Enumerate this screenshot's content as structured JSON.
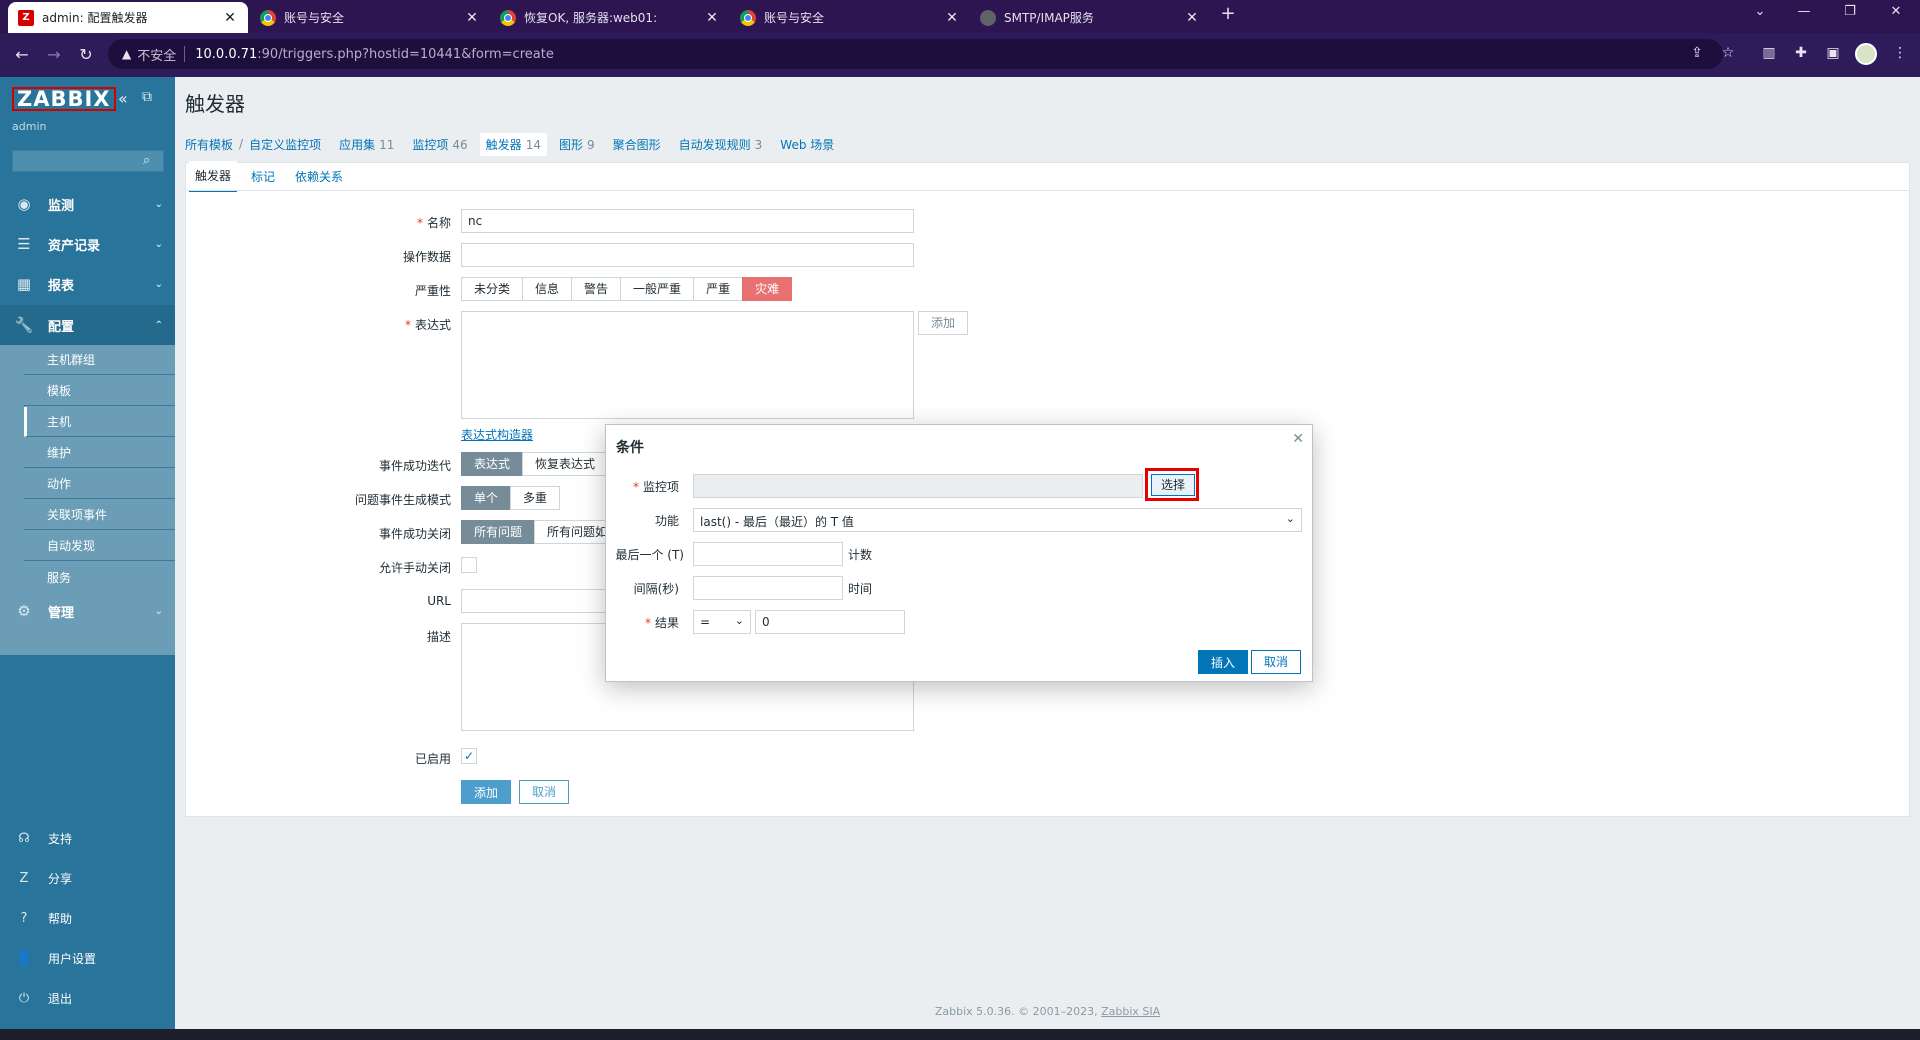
{
  "browser": {
    "tabs": [
      {
        "title": "admin: 配置触发器",
        "icon": "zabbix-icon",
        "active": true
      },
      {
        "title": "账号与安全",
        "icon": "chrome-icon"
      },
      {
        "title": "恢复OK, 服务器:web01:",
        "icon": "chrome-icon"
      },
      {
        "title": "账号与安全",
        "icon": "chrome-icon"
      },
      {
        "title": "SMTP/IMAP服务",
        "icon": "globe-icon"
      }
    ],
    "insecure_label": "不安全",
    "url_host": "10.0.0.71",
    "url_path": ":90/triggers.php?hostid=10441&form=create"
  },
  "sidebar": {
    "logo": "ZABBIX",
    "user": "admin",
    "menu": [
      {
        "label": "监测",
        "icon": "eye-icon"
      },
      {
        "label": "资产记录",
        "icon": "list-icon"
      },
      {
        "label": "报表",
        "icon": "chart-icon"
      },
      {
        "label": "配置",
        "icon": "wrench-icon"
      },
      {
        "label": "管理",
        "icon": "gear-icon"
      }
    ],
    "config_submenu": [
      "主机群组",
      "模板",
      "主机",
      "维护",
      "动作",
      "关联项事件",
      "自动发现",
      "服务"
    ],
    "bottom": [
      {
        "label": "支持",
        "icon": "headset-icon"
      },
      {
        "label": "分享",
        "icon": "share-icon"
      },
      {
        "label": "帮助",
        "icon": "help-icon"
      },
      {
        "label": "用户设置",
        "icon": "user-icon"
      },
      {
        "label": "退出",
        "icon": "power-icon"
      }
    ]
  },
  "page": {
    "title": "触发器",
    "breadcrumbs": {
      "all_templates": "所有模板",
      "template": "自定义监控项",
      "applications": "应用集",
      "applications_count": "11",
      "items": "监控项",
      "items_count": "46",
      "triggers": "触发器",
      "triggers_count": "14",
      "graphs": "图形",
      "graphs_count": "9",
      "screens": "聚合图形",
      "discovery": "自动发现规则",
      "discovery_count": "3",
      "web": "Web 场景"
    },
    "tabs": [
      "触发器",
      "标记",
      "依赖关系"
    ]
  },
  "form": {
    "name_label": "名称",
    "name_value": "nc",
    "opdata_label": "操作数据",
    "severity_label": "严重性",
    "severities": [
      "未分类",
      "信息",
      "警告",
      "一般严重",
      "严重",
      "灾难"
    ],
    "expression_label": "表达式",
    "add_button": "添加",
    "expression_builder": "表达式构造器",
    "ok_event_label": "事件成功迭代",
    "ok_event_options": [
      "表达式",
      "恢复表达式"
    ],
    "problem_mode_label": "问题事件生成模式",
    "problem_mode_options": [
      "单个",
      "多重"
    ],
    "ok_close_label": "事件成功关闭",
    "ok_close_options": [
      "所有问题",
      "所有问题如"
    ],
    "manual_close_label": "允许手动关闭",
    "url_label": "URL",
    "description_label": "描述",
    "enabled_label": "已启用",
    "submit": "添加",
    "cancel": "取消"
  },
  "dialog": {
    "title": "条件",
    "item_label": "监控项",
    "select_button": "选择",
    "function_label": "功能",
    "function_value": "last() - 最后（最近）的 T 值",
    "last_label": "最后一个 (T)",
    "last_suffix": "计数",
    "interval_label": "间隔(秒)",
    "interval_suffix": "时间",
    "result_label": "结果",
    "result_op": "=",
    "result_value": "0",
    "insert_button": "插入",
    "cancel_button": "取消"
  },
  "footer": {
    "text": "Zabbix 5.0.36. © 2001–2023, ",
    "link": "Zabbix SIA"
  },
  "colors": {
    "sidebar": "#29749a",
    "accent": "#0275b8",
    "disaster": "#e45959",
    "highlight": "#e60000"
  }
}
